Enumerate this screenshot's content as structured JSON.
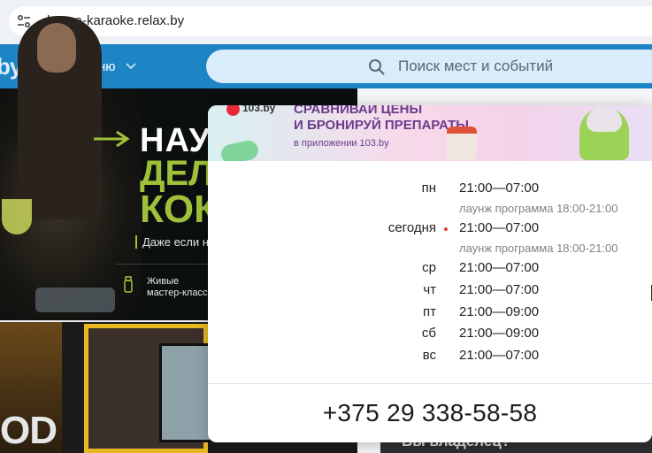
{
  "browser": {
    "url": "druzya-karaoke.relax.by"
  },
  "site_header": {
    "logo_fragment": "by",
    "menu_label": "Меню",
    "search_placeholder": "Поиск мест и событий"
  },
  "banner_top": {
    "headline_white": "НАУЧ",
    "headline_green_1": "ДЕЛА",
    "headline_green_2": "КОК",
    "subtitle": "Даже если н",
    "feature_line_1": "Живые",
    "feature_line_2": "мастер-классы"
  },
  "banner_bottom": {
    "text_fragment": "OD"
  },
  "bottom_card": {
    "text_fragment": "Вы владелец?"
  },
  "popup": {
    "ad": {
      "brand": "103.by",
      "headline_line_1": "СРАВНИВАЙ ЦЕНЫ",
      "headline_line_2": "И БРОНИРУЙ ПРЕПАРАТЫ",
      "subline": "в приложении 103.by"
    },
    "schedule": [
      {
        "day": "пн",
        "time": "21:00—07:00",
        "note": "лаунж программа 18:00-21:00",
        "today": false
      },
      {
        "day": "сегодня",
        "time": "21:00—07:00",
        "note": "лаунж программа 18:00-21:00",
        "today": true
      },
      {
        "day": "ср",
        "time": "21:00—07:00",
        "note": "",
        "today": false
      },
      {
        "day": "чт",
        "time": "21:00—07:00",
        "note": "",
        "today": false
      },
      {
        "day": "пт",
        "time": "21:00—09:00",
        "note": "",
        "today": false
      },
      {
        "day": "сб",
        "time": "21:00—09:00",
        "note": "",
        "today": false
      },
      {
        "day": "вс",
        "time": "21:00—07:00",
        "note": "",
        "today": false
      }
    ],
    "phone": "+375 29 338-58-58"
  },
  "colors": {
    "header_blue": "#1d84c6",
    "today_dot": "#e33b3b",
    "banner_green": "#9fc13a"
  }
}
